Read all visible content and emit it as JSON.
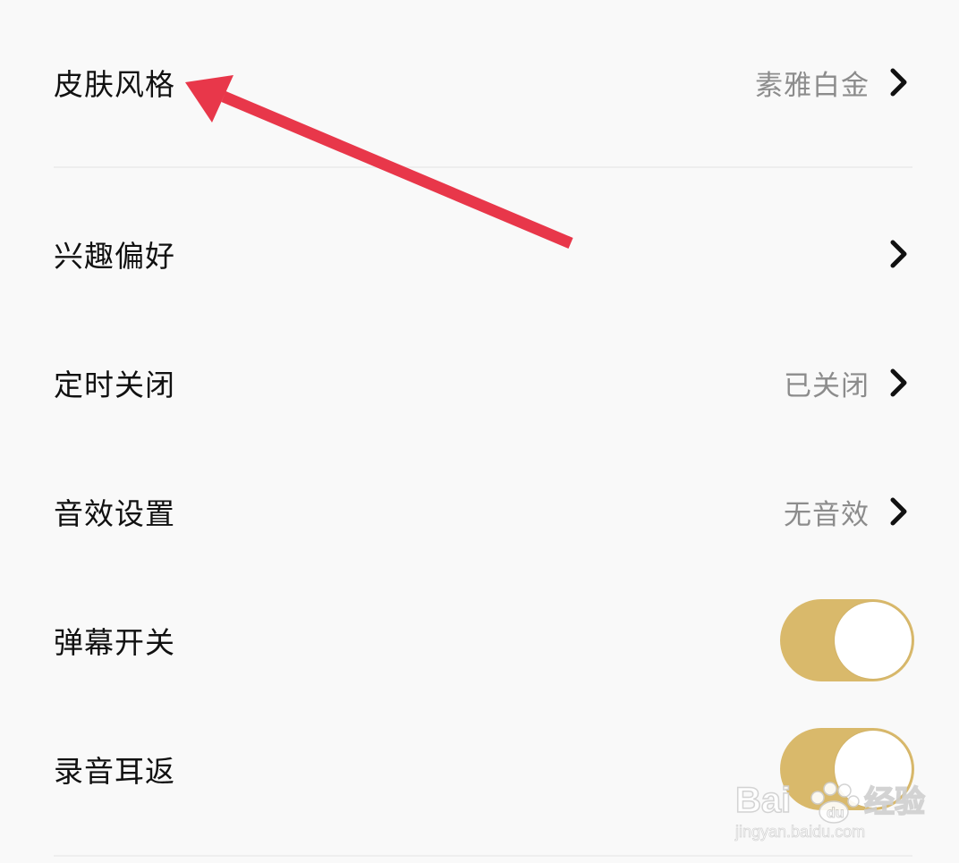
{
  "settings": {
    "rows": [
      {
        "label": "皮肤风格",
        "value": "素雅白金",
        "chevron": true
      },
      {
        "label": "兴趣偏好",
        "value": "",
        "chevron": true
      },
      {
        "label": "定时关闭",
        "value": "已关闭",
        "chevron": true
      },
      {
        "label": "音效设置",
        "value": "无音效",
        "chevron": true
      },
      {
        "label": "弹幕开关",
        "toggle": true,
        "on": true
      },
      {
        "label": "录音耳返",
        "toggle": true,
        "on": true
      }
    ]
  },
  "colors": {
    "background": "#f9f9f9",
    "toggle_on": "#d9b96b",
    "annotation_arrow": "#e8374a",
    "value_text": "#8c8c8c",
    "label_text": "#111111"
  },
  "watermark": {
    "brand": "Bai",
    "brand_suffix": "du",
    "product": "经验",
    "url": "jingyan.baidu.com"
  }
}
